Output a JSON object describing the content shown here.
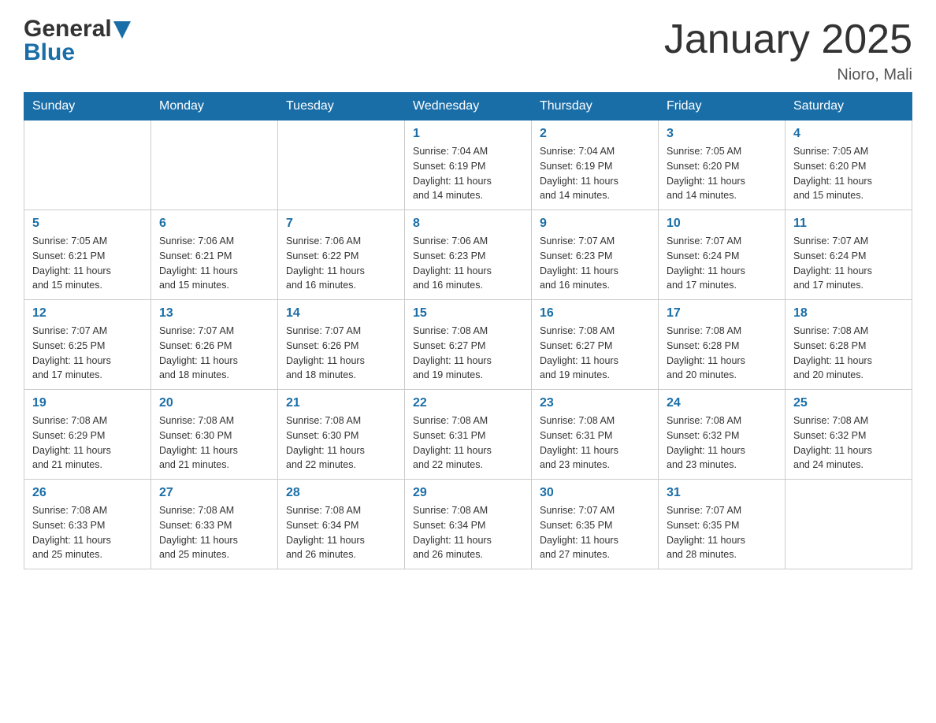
{
  "logo": {
    "general": "General",
    "blue": "Blue"
  },
  "title": "January 2025",
  "location": "Nioro, Mali",
  "days_of_week": [
    "Sunday",
    "Monday",
    "Tuesday",
    "Wednesday",
    "Thursday",
    "Friday",
    "Saturday"
  ],
  "weeks": [
    [
      {
        "day": "",
        "info": ""
      },
      {
        "day": "",
        "info": ""
      },
      {
        "day": "",
        "info": ""
      },
      {
        "day": "1",
        "info": "Sunrise: 7:04 AM\nSunset: 6:19 PM\nDaylight: 11 hours\nand 14 minutes."
      },
      {
        "day": "2",
        "info": "Sunrise: 7:04 AM\nSunset: 6:19 PM\nDaylight: 11 hours\nand 14 minutes."
      },
      {
        "day": "3",
        "info": "Sunrise: 7:05 AM\nSunset: 6:20 PM\nDaylight: 11 hours\nand 14 minutes."
      },
      {
        "day": "4",
        "info": "Sunrise: 7:05 AM\nSunset: 6:20 PM\nDaylight: 11 hours\nand 15 minutes."
      }
    ],
    [
      {
        "day": "5",
        "info": "Sunrise: 7:05 AM\nSunset: 6:21 PM\nDaylight: 11 hours\nand 15 minutes."
      },
      {
        "day": "6",
        "info": "Sunrise: 7:06 AM\nSunset: 6:21 PM\nDaylight: 11 hours\nand 15 minutes."
      },
      {
        "day": "7",
        "info": "Sunrise: 7:06 AM\nSunset: 6:22 PM\nDaylight: 11 hours\nand 16 minutes."
      },
      {
        "day": "8",
        "info": "Sunrise: 7:06 AM\nSunset: 6:23 PM\nDaylight: 11 hours\nand 16 minutes."
      },
      {
        "day": "9",
        "info": "Sunrise: 7:07 AM\nSunset: 6:23 PM\nDaylight: 11 hours\nand 16 minutes."
      },
      {
        "day": "10",
        "info": "Sunrise: 7:07 AM\nSunset: 6:24 PM\nDaylight: 11 hours\nand 17 minutes."
      },
      {
        "day": "11",
        "info": "Sunrise: 7:07 AM\nSunset: 6:24 PM\nDaylight: 11 hours\nand 17 minutes."
      }
    ],
    [
      {
        "day": "12",
        "info": "Sunrise: 7:07 AM\nSunset: 6:25 PM\nDaylight: 11 hours\nand 17 minutes."
      },
      {
        "day": "13",
        "info": "Sunrise: 7:07 AM\nSunset: 6:26 PM\nDaylight: 11 hours\nand 18 minutes."
      },
      {
        "day": "14",
        "info": "Sunrise: 7:07 AM\nSunset: 6:26 PM\nDaylight: 11 hours\nand 18 minutes."
      },
      {
        "day": "15",
        "info": "Sunrise: 7:08 AM\nSunset: 6:27 PM\nDaylight: 11 hours\nand 19 minutes."
      },
      {
        "day": "16",
        "info": "Sunrise: 7:08 AM\nSunset: 6:27 PM\nDaylight: 11 hours\nand 19 minutes."
      },
      {
        "day": "17",
        "info": "Sunrise: 7:08 AM\nSunset: 6:28 PM\nDaylight: 11 hours\nand 20 minutes."
      },
      {
        "day": "18",
        "info": "Sunrise: 7:08 AM\nSunset: 6:28 PM\nDaylight: 11 hours\nand 20 minutes."
      }
    ],
    [
      {
        "day": "19",
        "info": "Sunrise: 7:08 AM\nSunset: 6:29 PM\nDaylight: 11 hours\nand 21 minutes."
      },
      {
        "day": "20",
        "info": "Sunrise: 7:08 AM\nSunset: 6:30 PM\nDaylight: 11 hours\nand 21 minutes."
      },
      {
        "day": "21",
        "info": "Sunrise: 7:08 AM\nSunset: 6:30 PM\nDaylight: 11 hours\nand 22 minutes."
      },
      {
        "day": "22",
        "info": "Sunrise: 7:08 AM\nSunset: 6:31 PM\nDaylight: 11 hours\nand 22 minutes."
      },
      {
        "day": "23",
        "info": "Sunrise: 7:08 AM\nSunset: 6:31 PM\nDaylight: 11 hours\nand 23 minutes."
      },
      {
        "day": "24",
        "info": "Sunrise: 7:08 AM\nSunset: 6:32 PM\nDaylight: 11 hours\nand 23 minutes."
      },
      {
        "day": "25",
        "info": "Sunrise: 7:08 AM\nSunset: 6:32 PM\nDaylight: 11 hours\nand 24 minutes."
      }
    ],
    [
      {
        "day": "26",
        "info": "Sunrise: 7:08 AM\nSunset: 6:33 PM\nDaylight: 11 hours\nand 25 minutes."
      },
      {
        "day": "27",
        "info": "Sunrise: 7:08 AM\nSunset: 6:33 PM\nDaylight: 11 hours\nand 25 minutes."
      },
      {
        "day": "28",
        "info": "Sunrise: 7:08 AM\nSunset: 6:34 PM\nDaylight: 11 hours\nand 26 minutes."
      },
      {
        "day": "29",
        "info": "Sunrise: 7:08 AM\nSunset: 6:34 PM\nDaylight: 11 hours\nand 26 minutes."
      },
      {
        "day": "30",
        "info": "Sunrise: 7:07 AM\nSunset: 6:35 PM\nDaylight: 11 hours\nand 27 minutes."
      },
      {
        "day": "31",
        "info": "Sunrise: 7:07 AM\nSunset: 6:35 PM\nDaylight: 11 hours\nand 28 minutes."
      },
      {
        "day": "",
        "info": ""
      }
    ]
  ],
  "colors": {
    "header_bg": "#1a6ea8",
    "accent": "#1a6ea8",
    "border": "#ccc"
  }
}
